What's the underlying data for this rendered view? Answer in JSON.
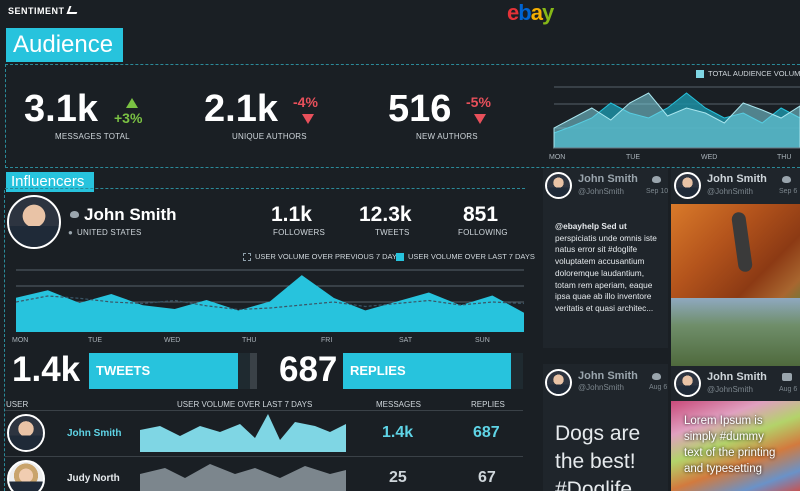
{
  "brand": {
    "name": "SENTIMENT",
    "partner": [
      "e",
      "b",
      "a",
      "y"
    ]
  },
  "audience": {
    "title": "Audience",
    "metrics": [
      {
        "value": "3.1k",
        "delta": "+3%",
        "direction": "up",
        "label": "MESSAGES TOTAL"
      },
      {
        "value": "2.1k",
        "delta": "-4%",
        "direction": "down",
        "label": "UNIQUE AUTHORS"
      },
      {
        "value": "516",
        "delta": "-5%",
        "direction": "down",
        "label": "NEW AUTHORS"
      }
    ],
    "chart_legend": "TOTAL AUDIENCE VOLUME O",
    "chart_days": [
      "MON",
      "TUE",
      "WED",
      "THU"
    ]
  },
  "influencers": {
    "title": "Influencers",
    "profile": {
      "name": "John Smith",
      "location": "UNITED STATES",
      "followers": "1.1k",
      "followers_label": "FOLLOWERS",
      "tweets": "12.3k",
      "tweets_label": "TWEETS",
      "following": "851",
      "following_label": "FOLLOWING"
    },
    "legend_prev": "USER VOLUME OVER PREVIOUS 7 DAYS",
    "legend_last": "USER VOLUME OVER LAST 7 DAYS",
    "days": [
      "MON",
      "TUE",
      "WED",
      "THU",
      "FRI",
      "SAT",
      "SUN"
    ],
    "tweets_total": "1.4k",
    "tweets_label": "TWEETS",
    "replies_total": "687",
    "replies_label": "REPLIES",
    "table_headers": {
      "user": "USER",
      "volume": "USER VOLUME OVER LAST 7 DAYS",
      "messages": "MESSAGES",
      "replies": "REPLIES"
    },
    "rows": [
      {
        "name": "John Smith",
        "messages": "1.4k",
        "replies": "687"
      },
      {
        "name": "Judy North",
        "messages": "25",
        "replies": "67"
      }
    ]
  },
  "tweets": [
    {
      "name": "John Smith",
      "handle": "@JohnSmith",
      "date": "Sep 10",
      "text": [
        "@ebayhelp Sed ut",
        "perspiciatis unde omnis iste",
        "natus error sit #doglife",
        "voluptatem accusantium",
        "doloremque laudantium,",
        "totam rem aperiam, eaque",
        "ipsa quae ab illo inventore",
        "veritatis et quasi architec..."
      ]
    },
    {
      "name": "John Smith",
      "handle": "@JohnSmith",
      "date": "Sep 6"
    },
    {
      "name": "John Smith",
      "handle": "@JohnSmith",
      "date": "Aug 6",
      "big_text": [
        "Dogs are",
        "the best!",
        "#Doglife"
      ]
    },
    {
      "name": "John Smith",
      "handle": "@JohnSmith",
      "date": "Aug 6",
      "overlay_text": [
        "Lorem Ipsum is",
        "simply #dummy",
        "text of the printing",
        "and typesetting"
      ]
    }
  ],
  "colors": {
    "accent": "#27c3dd",
    "positive": "#7ac143",
    "negative": "#e8505b",
    "background": "#1a1f24"
  },
  "chart_data": [
    {
      "type": "area",
      "legend": "TOTAL AUDIENCE VOLUME O",
      "categories": [
        "MON",
        "TUE",
        "WED",
        "THU"
      ],
      "series": [
        {
          "name": "current",
          "values": [
            20,
            30,
            40,
            28,
            45,
            55,
            32,
            40,
            35,
            25,
            45,
            38,
            30,
            42
          ]
        },
        {
          "name": "previous",
          "values": [
            15,
            22,
            30,
            45,
            35,
            30,
            40,
            55,
            40,
            30,
            35,
            25,
            40,
            30
          ]
        }
      ]
    },
    {
      "type": "area",
      "legend": [
        "USER VOLUME OVER PREVIOUS 7 DAYS",
        "USER VOLUME OVER LAST 7 DAYS"
      ],
      "categories": [
        "MON",
        "TUE",
        "WED",
        "THU",
        "FRI",
        "SAT",
        "SUN"
      ],
      "series": [
        {
          "name": "USER VOLUME OVER LAST 7 DAYS",
          "values": [
            45,
            55,
            38,
            50,
            35,
            30,
            42,
            28,
            40,
            75,
            45,
            28,
            40,
            52,
            35,
            48,
            25
          ]
        },
        {
          "name": "USER VOLUME OVER PREVIOUS 7 DAYS",
          "values": [
            40,
            48,
            45,
            40,
            38,
            42,
            35,
            30,
            32,
            36,
            40,
            34,
            38,
            42,
            36,
            40,
            38
          ]
        }
      ]
    }
  ]
}
